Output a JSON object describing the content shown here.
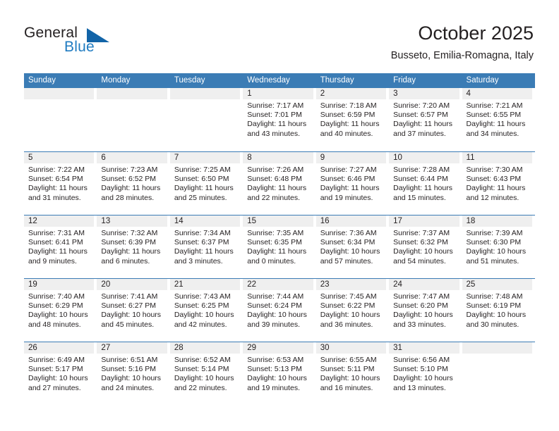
{
  "brand": {
    "name_part1": "General",
    "name_part2": "Blue",
    "triangle_color": "#1264a8",
    "blue_color": "#1f7bc1"
  },
  "header": {
    "title": "October 2025",
    "subtitle": "Busseto, Emilia-Romagna, Italy",
    "header_bg": "#3b7cb5",
    "day_strip_bg": "#efefef"
  },
  "weekday_headers": [
    "Sunday",
    "Monday",
    "Tuesday",
    "Wednesday",
    "Thursday",
    "Friday",
    "Saturday"
  ],
  "weeks": [
    [
      {
        "day": "",
        "empty": true,
        "sunrise": "",
        "sunset": "",
        "daylight_line1": "",
        "daylight_line2": ""
      },
      {
        "day": "",
        "empty": true,
        "sunrise": "",
        "sunset": "",
        "daylight_line1": "",
        "daylight_line2": ""
      },
      {
        "day": "",
        "empty": true,
        "sunrise": "",
        "sunset": "",
        "daylight_line1": "",
        "daylight_line2": ""
      },
      {
        "day": "1",
        "empty": false,
        "sunrise": "Sunrise: 7:17 AM",
        "sunset": "Sunset: 7:01 PM",
        "daylight_line1": "Daylight: 11 hours",
        "daylight_line2": "and 43 minutes."
      },
      {
        "day": "2",
        "empty": false,
        "sunrise": "Sunrise: 7:18 AM",
        "sunset": "Sunset: 6:59 PM",
        "daylight_line1": "Daylight: 11 hours",
        "daylight_line2": "and 40 minutes."
      },
      {
        "day": "3",
        "empty": false,
        "sunrise": "Sunrise: 7:20 AM",
        "sunset": "Sunset: 6:57 PM",
        "daylight_line1": "Daylight: 11 hours",
        "daylight_line2": "and 37 minutes."
      },
      {
        "day": "4",
        "empty": false,
        "sunrise": "Sunrise: 7:21 AM",
        "sunset": "Sunset: 6:55 PM",
        "daylight_line1": "Daylight: 11 hours",
        "daylight_line2": "and 34 minutes."
      }
    ],
    [
      {
        "day": "5",
        "empty": false,
        "sunrise": "Sunrise: 7:22 AM",
        "sunset": "Sunset: 6:54 PM",
        "daylight_line1": "Daylight: 11 hours",
        "daylight_line2": "and 31 minutes."
      },
      {
        "day": "6",
        "empty": false,
        "sunrise": "Sunrise: 7:23 AM",
        "sunset": "Sunset: 6:52 PM",
        "daylight_line1": "Daylight: 11 hours",
        "daylight_line2": "and 28 minutes."
      },
      {
        "day": "7",
        "empty": false,
        "sunrise": "Sunrise: 7:25 AM",
        "sunset": "Sunset: 6:50 PM",
        "daylight_line1": "Daylight: 11 hours",
        "daylight_line2": "and 25 minutes."
      },
      {
        "day": "8",
        "empty": false,
        "sunrise": "Sunrise: 7:26 AM",
        "sunset": "Sunset: 6:48 PM",
        "daylight_line1": "Daylight: 11 hours",
        "daylight_line2": "and 22 minutes."
      },
      {
        "day": "9",
        "empty": false,
        "sunrise": "Sunrise: 7:27 AM",
        "sunset": "Sunset: 6:46 PM",
        "daylight_line1": "Daylight: 11 hours",
        "daylight_line2": "and 19 minutes."
      },
      {
        "day": "10",
        "empty": false,
        "sunrise": "Sunrise: 7:28 AM",
        "sunset": "Sunset: 6:44 PM",
        "daylight_line1": "Daylight: 11 hours",
        "daylight_line2": "and 15 minutes."
      },
      {
        "day": "11",
        "empty": false,
        "sunrise": "Sunrise: 7:30 AM",
        "sunset": "Sunset: 6:43 PM",
        "daylight_line1": "Daylight: 11 hours",
        "daylight_line2": "and 12 minutes."
      }
    ],
    [
      {
        "day": "12",
        "empty": false,
        "sunrise": "Sunrise: 7:31 AM",
        "sunset": "Sunset: 6:41 PM",
        "daylight_line1": "Daylight: 11 hours",
        "daylight_line2": "and 9 minutes."
      },
      {
        "day": "13",
        "empty": false,
        "sunrise": "Sunrise: 7:32 AM",
        "sunset": "Sunset: 6:39 PM",
        "daylight_line1": "Daylight: 11 hours",
        "daylight_line2": "and 6 minutes."
      },
      {
        "day": "14",
        "empty": false,
        "sunrise": "Sunrise: 7:34 AM",
        "sunset": "Sunset: 6:37 PM",
        "daylight_line1": "Daylight: 11 hours",
        "daylight_line2": "and 3 minutes."
      },
      {
        "day": "15",
        "empty": false,
        "sunrise": "Sunrise: 7:35 AM",
        "sunset": "Sunset: 6:35 PM",
        "daylight_line1": "Daylight: 11 hours",
        "daylight_line2": "and 0 minutes."
      },
      {
        "day": "16",
        "empty": false,
        "sunrise": "Sunrise: 7:36 AM",
        "sunset": "Sunset: 6:34 PM",
        "daylight_line1": "Daylight: 10 hours",
        "daylight_line2": "and 57 minutes."
      },
      {
        "day": "17",
        "empty": false,
        "sunrise": "Sunrise: 7:37 AM",
        "sunset": "Sunset: 6:32 PM",
        "daylight_line1": "Daylight: 10 hours",
        "daylight_line2": "and 54 minutes."
      },
      {
        "day": "18",
        "empty": false,
        "sunrise": "Sunrise: 7:39 AM",
        "sunset": "Sunset: 6:30 PM",
        "daylight_line1": "Daylight: 10 hours",
        "daylight_line2": "and 51 minutes."
      }
    ],
    [
      {
        "day": "19",
        "empty": false,
        "sunrise": "Sunrise: 7:40 AM",
        "sunset": "Sunset: 6:29 PM",
        "daylight_line1": "Daylight: 10 hours",
        "daylight_line2": "and 48 minutes."
      },
      {
        "day": "20",
        "empty": false,
        "sunrise": "Sunrise: 7:41 AM",
        "sunset": "Sunset: 6:27 PM",
        "daylight_line1": "Daylight: 10 hours",
        "daylight_line2": "and 45 minutes."
      },
      {
        "day": "21",
        "empty": false,
        "sunrise": "Sunrise: 7:43 AM",
        "sunset": "Sunset: 6:25 PM",
        "daylight_line1": "Daylight: 10 hours",
        "daylight_line2": "and 42 minutes."
      },
      {
        "day": "22",
        "empty": false,
        "sunrise": "Sunrise: 7:44 AM",
        "sunset": "Sunset: 6:24 PM",
        "daylight_line1": "Daylight: 10 hours",
        "daylight_line2": "and 39 minutes."
      },
      {
        "day": "23",
        "empty": false,
        "sunrise": "Sunrise: 7:45 AM",
        "sunset": "Sunset: 6:22 PM",
        "daylight_line1": "Daylight: 10 hours",
        "daylight_line2": "and 36 minutes."
      },
      {
        "day": "24",
        "empty": false,
        "sunrise": "Sunrise: 7:47 AM",
        "sunset": "Sunset: 6:20 PM",
        "daylight_line1": "Daylight: 10 hours",
        "daylight_line2": "and 33 minutes."
      },
      {
        "day": "25",
        "empty": false,
        "sunrise": "Sunrise: 7:48 AM",
        "sunset": "Sunset: 6:19 PM",
        "daylight_line1": "Daylight: 10 hours",
        "daylight_line2": "and 30 minutes."
      }
    ],
    [
      {
        "day": "26",
        "empty": false,
        "sunrise": "Sunrise: 6:49 AM",
        "sunset": "Sunset: 5:17 PM",
        "daylight_line1": "Daylight: 10 hours",
        "daylight_line2": "and 27 minutes."
      },
      {
        "day": "27",
        "empty": false,
        "sunrise": "Sunrise: 6:51 AM",
        "sunset": "Sunset: 5:16 PM",
        "daylight_line1": "Daylight: 10 hours",
        "daylight_line2": "and 24 minutes."
      },
      {
        "day": "28",
        "empty": false,
        "sunrise": "Sunrise: 6:52 AM",
        "sunset": "Sunset: 5:14 PM",
        "daylight_line1": "Daylight: 10 hours",
        "daylight_line2": "and 22 minutes."
      },
      {
        "day": "29",
        "empty": false,
        "sunrise": "Sunrise: 6:53 AM",
        "sunset": "Sunset: 5:13 PM",
        "daylight_line1": "Daylight: 10 hours",
        "daylight_line2": "and 19 minutes."
      },
      {
        "day": "30",
        "empty": false,
        "sunrise": "Sunrise: 6:55 AM",
        "sunset": "Sunset: 5:11 PM",
        "daylight_line1": "Daylight: 10 hours",
        "daylight_line2": "and 16 minutes."
      },
      {
        "day": "31",
        "empty": false,
        "sunrise": "Sunrise: 6:56 AM",
        "sunset": "Sunset: 5:10 PM",
        "daylight_line1": "Daylight: 10 hours",
        "daylight_line2": "and 13 minutes."
      },
      {
        "day": "",
        "empty": true,
        "sunrise": "",
        "sunset": "",
        "daylight_line1": "",
        "daylight_line2": ""
      }
    ]
  ]
}
